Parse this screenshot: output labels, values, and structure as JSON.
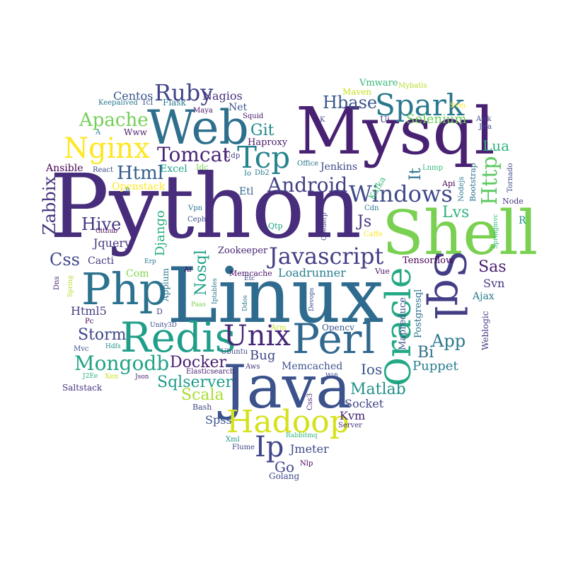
{
  "words": [
    {
      "text": "Python",
      "color": "#472d7b"
    },
    {
      "text": "Linux",
      "color": "#2f6b8e"
    },
    {
      "text": "Mysql",
      "color": "#482173"
    },
    {
      "text": "Java",
      "color": "#3b528b"
    },
    {
      "text": "Shell",
      "color": "#7ad151"
    },
    {
      "text": "Web",
      "color": "#2e6f8e"
    },
    {
      "text": "Php",
      "color": "#2c728e"
    },
    {
      "text": "Redis",
      "color": "#1f9e89"
    },
    {
      "text": "Perl",
      "color": "#31688e"
    },
    {
      "text": "Oracle",
      "color": "#22a884"
    },
    {
      "text": "Sql",
      "color": "#433e85"
    },
    {
      "text": "Hadoop",
      "color": "#d5e21a"
    },
    {
      "text": "Unix",
      "color": "#482878"
    },
    {
      "text": "Spark",
      "color": "#2a788e"
    },
    {
      "text": "Nginx",
      "color": "#fde725"
    },
    {
      "text": "Tcp",
      "color": "#25838e"
    },
    {
      "text": "Windows",
      "color": "#3e4a89"
    },
    {
      "text": "Javascript",
      "color": "#433e85"
    },
    {
      "text": "Ruby",
      "color": "#414487"
    },
    {
      "text": "Tomcat",
      "color": "#482475"
    },
    {
      "text": "Android",
      "color": "#424086"
    },
    {
      "text": "Mongodb",
      "color": "#20a386"
    },
    {
      "text": "Ip",
      "color": "#404688"
    },
    {
      "text": "Hbase",
      "color": "#39568c"
    },
    {
      "text": "Http",
      "color": "#5ec962"
    },
    {
      "text": "Apache",
      "color": "#73d056"
    },
    {
      "text": "Html",
      "color": "#365d8d"
    },
    {
      "text": "Zabbix",
      "color": "#46317e"
    },
    {
      "text": "Hive",
      "color": "#453882"
    },
    {
      "text": "Css",
      "color": "#3e4989"
    },
    {
      "text": "Sqlserver",
      "color": "#1e9b8a"
    },
    {
      "text": "Docker",
      "color": "#481d6f"
    },
    {
      "text": "Matlab",
      "color": "#21918c"
    },
    {
      "text": "Storm",
      "color": "#3f4788"
    },
    {
      "text": "Sas",
      "color": "#481c6e"
    },
    {
      "text": "App",
      "color": "#2a788e"
    },
    {
      "text": "Nosql",
      "color": "#1fa088"
    },
    {
      "text": "Git",
      "color": "#24868e"
    },
    {
      "text": "Lvs",
      "color": "#2db27d"
    },
    {
      "text": "Scala",
      "color": "#aadc32"
    },
    {
      "text": "Lua",
      "color": "#2db27d"
    },
    {
      "text": "Js",
      "color": "#46337f"
    },
    {
      "text": "It",
      "color": "#2c728e"
    },
    {
      "text": "Django",
      "color": "#26ad81"
    },
    {
      "text": "Bug",
      "color": "#3e4989"
    },
    {
      "text": "Bi",
      "color": "#2e6e8e"
    },
    {
      "text": "Ios",
      "color": "#3b528b"
    },
    {
      "text": "Puppet",
      "color": "#277f8e"
    },
    {
      "text": "Memcached",
      "color": "#3b528b"
    },
    {
      "text": "Selenium",
      "color": "#6ccd5a"
    },
    {
      "text": "Socket",
      "color": "#3f4788"
    },
    {
      "text": "Centos",
      "color": "#39558c"
    },
    {
      "text": "Nagios",
      "color": "#46307e"
    },
    {
      "text": "Jquery",
      "color": "#453781"
    },
    {
      "text": "Svn",
      "color": "#46327e"
    },
    {
      "text": "Html5",
      "color": "#433e85"
    },
    {
      "text": "Kvm",
      "color": "#482173"
    },
    {
      "text": "Loadrunner",
      "color": "#287c8e"
    },
    {
      "text": "Jmeter",
      "color": "#3e4a89"
    },
    {
      "text": "Spss",
      "color": "#3b528b"
    },
    {
      "text": "Go",
      "color": "#404588"
    },
    {
      "text": "Net",
      "color": "#39558c"
    },
    {
      "text": "Ansible",
      "color": "#440154"
    },
    {
      "text": "Cacti",
      "color": "#453781"
    },
    {
      "text": "Haproxy",
      "color": "#481769"
    },
    {
      "text": "Jenkins",
      "color": "#3e4989"
    },
    {
      "text": "Openstack",
      "color": "#fde725"
    },
    {
      "text": "Excel",
      "color": "#1f9e89"
    },
    {
      "text": "Etl",
      "color": "#33638d"
    },
    {
      "text": "Com",
      "color": "#7fd34e"
    },
    {
      "text": "Tensorflow",
      "color": "#440154"
    },
    {
      "text": "Zookeeper",
      "color": "#482576"
    },
    {
      "text": "Postgresql",
      "color": "#2c728e"
    },
    {
      "text": "Mapreduce",
      "color": "#3b528b"
    },
    {
      "text": "Weblogic",
      "color": "#46327e"
    },
    {
      "text": "Ajax",
      "color": "#2a788e"
    },
    {
      "text": "Opencv",
      "color": "#39568c"
    },
    {
      "text": "Appium",
      "color": "#2a788e"
    },
    {
      "text": "Maven",
      "color": "#c8e020"
    },
    {
      "text": "Vmware",
      "color": "#35b779"
    },
    {
      "text": "Kafka",
      "color": "#38b977"
    },
    {
      "text": "Golang",
      "color": "#3e4989"
    },
    {
      "text": "Bootstrap",
      "color": "#2d708e"
    },
    {
      "text": "Memcache",
      "color": "#471063"
    },
    {
      "text": "Flask",
      "color": "#2a788e"
    },
    {
      "text": "Vue",
      "color": "#481668"
    },
    {
      "text": "Saltstack",
      "color": "#46327e"
    },
    {
      "text": "Mybatis",
      "color": "#b5de2b"
    },
    {
      "text": "Elasticsearch",
      "color": "#481f70"
    },
    {
      "text": "Keepalived",
      "color": "#2a788e"
    },
    {
      "text": "Maya",
      "color": "#471365"
    },
    {
      "text": "Squid",
      "color": "#481c6e"
    },
    {
      "text": "Www",
      "color": "#481b6d"
    },
    {
      "text": "Tcl",
      "color": "#39558c"
    },
    {
      "text": "Ui",
      "color": "#453882"
    },
    {
      "text": "K",
      "color": "#3e4a89"
    },
    {
      "text": "Svm",
      "color": "#fde725"
    },
    {
      "text": "Awk",
      "color": "#404588"
    },
    {
      "text": "Jira",
      "color": "#3e4989"
    },
    {
      "text": "React",
      "color": "#3e4a89"
    },
    {
      "text": "Udp",
      "color": "#453882"
    },
    {
      "text": "Idc",
      "color": "#7ad151"
    },
    {
      "text": "Io",
      "color": "#2a788e"
    },
    {
      "text": "Db2",
      "color": "#2a788e"
    },
    {
      "text": "Office",
      "color": "#2a788e"
    },
    {
      "text": "Lnmp",
      "color": "#35b779"
    },
    {
      "text": "Api",
      "color": "#440154"
    },
    {
      "text": "Nodejs",
      "color": "#2a788e"
    },
    {
      "text": "Tornado",
      "color": "#3e4989"
    },
    {
      "text": "Node",
      "color": "#46327e"
    },
    {
      "text": "Vpn",
      "color": "#2a788e"
    },
    {
      "text": "Ceph",
      "color": "#3b528b"
    },
    {
      "text": "Cdn",
      "color": "#2a788e"
    },
    {
      "text": "Openerp",
      "color": "#414487"
    },
    {
      "text": "Caffe",
      "color": "#fde725"
    },
    {
      "text": "Springmvc",
      "color": "#35b779"
    },
    {
      "text": "R",
      "color": "#21918c"
    },
    {
      "text": "Github",
      "color": "#440154"
    },
    {
      "text": "Qtp",
      "color": "#20a386"
    },
    {
      "text": "Erp",
      "color": "#2a788e"
    },
    {
      "text": "Ai",
      "color": "#440154"
    },
    {
      "text": "Etc",
      "color": "#3e4989"
    },
    {
      "text": "Iptables",
      "color": "#2a788e"
    },
    {
      "text": "Ddos",
      "color": "#2a788e"
    },
    {
      "text": "Devops",
      "color": "#3e4989"
    },
    {
      "text": "Dns",
      "color": "#482878"
    },
    {
      "text": "Spring",
      "color": "#b5de2b"
    },
    {
      "text": "Paas",
      "color": "#7ad151"
    },
    {
      "text": "Pc",
      "color": "#440154"
    },
    {
      "text": "Unity3D",
      "color": "#3e4989"
    },
    {
      "text": "Arm",
      "color": "#c8e020"
    },
    {
      "text": "Hdfs",
      "color": "#21918c"
    },
    {
      "text": "Mvc",
      "color": "#3b528b"
    },
    {
      "text": "Ubuntu",
      "color": "#3e4989"
    },
    {
      "text": "Aws",
      "color": "#46327e"
    },
    {
      "text": "J2Ee",
      "color": "#2db27d"
    },
    {
      "text": "Xen",
      "color": "#c8e020"
    },
    {
      "text": "Json",
      "color": "#482475"
    },
    {
      "text": "Wifi",
      "color": "#3e4989"
    },
    {
      "text": "Css3",
      "color": "#481f70"
    },
    {
      "text": "Bash",
      "color": "#3e4989"
    },
    {
      "text": "Server",
      "color": "#46327e"
    },
    {
      "text": "Rabbitmq",
      "color": "#35b779"
    },
    {
      "text": "Xml",
      "color": "#21918c"
    },
    {
      "text": "Flume",
      "color": "#3e4989"
    },
    {
      "text": "Nlp",
      "color": "#440154"
    },
    {
      "text": "A",
      "color": "#2a788e"
    },
    {
      "text": "B",
      "color": "#2a788e"
    },
    {
      "text": "D",
      "color": "#3e4989"
    }
  ]
}
